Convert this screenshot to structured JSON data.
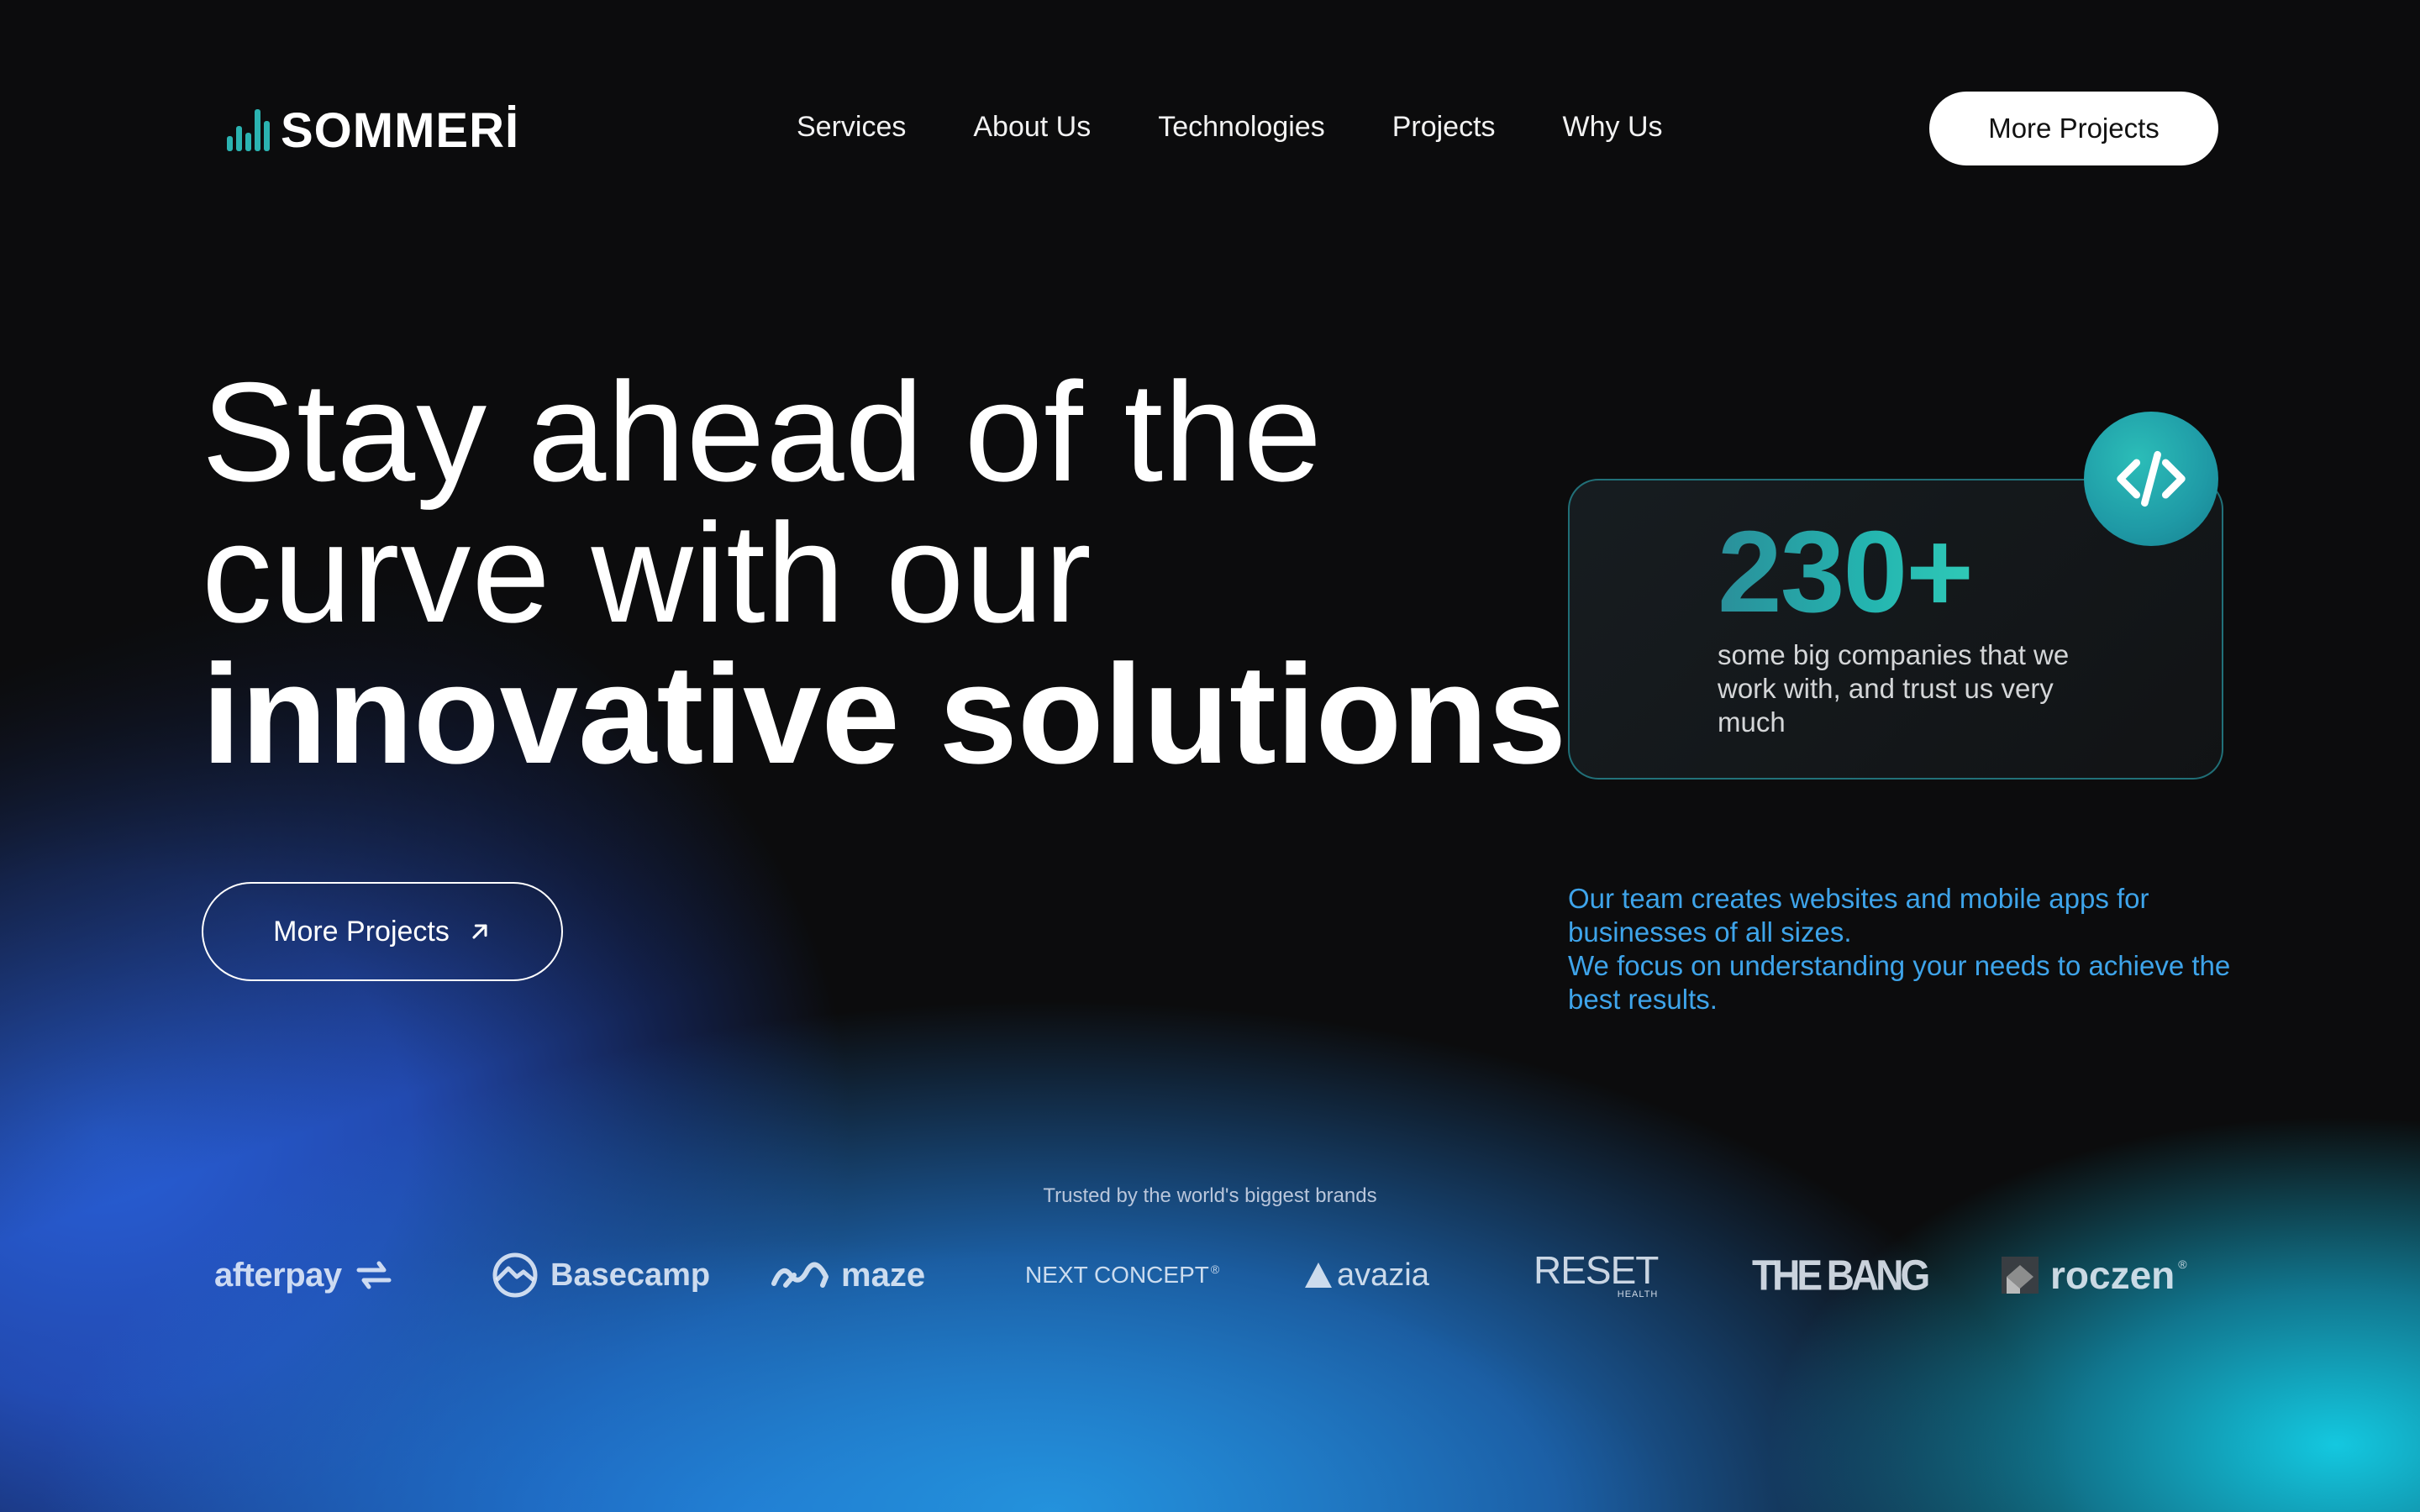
{
  "nav": {
    "logo_text": "SOMMERİ",
    "items": [
      {
        "label": "Services"
      },
      {
        "label": "About Us"
      },
      {
        "label": "Technologies"
      },
      {
        "label": "Projects"
      },
      {
        "label": "Why Us"
      }
    ],
    "cta_label": "More Projects"
  },
  "hero": {
    "line1": "Stay ahead of the",
    "line2": "curve with our",
    "line3": "innovative solutions",
    "button_label": "More Projects",
    "button_icon": "arrow-up-right-icon"
  },
  "stat": {
    "value": "230+",
    "text": "some big companies that we work with, and trust us very much",
    "badge_icon": "code-icon"
  },
  "description": {
    "line1": "Our team creates websites and mobile apps for businesses of all sizes.",
    "line2": "We focus on understanding your needs to achieve the best results."
  },
  "brands": {
    "heading": "Trusted by the world's biggest brands",
    "logos": [
      {
        "name": "afterpay"
      },
      {
        "name": "Basecamp"
      },
      {
        "name": "maze"
      },
      {
        "name": "NEXT CONCEPT"
      },
      {
        "name": "avazia"
      },
      {
        "name": "RESET",
        "sub": "HEALTH"
      },
      {
        "name": "THE BANG"
      },
      {
        "name": "roczen"
      }
    ]
  },
  "colors": {
    "accent_teal": "#2bb3b1",
    "description_blue": "#3ea4ea",
    "background": "#0c0c0d"
  }
}
